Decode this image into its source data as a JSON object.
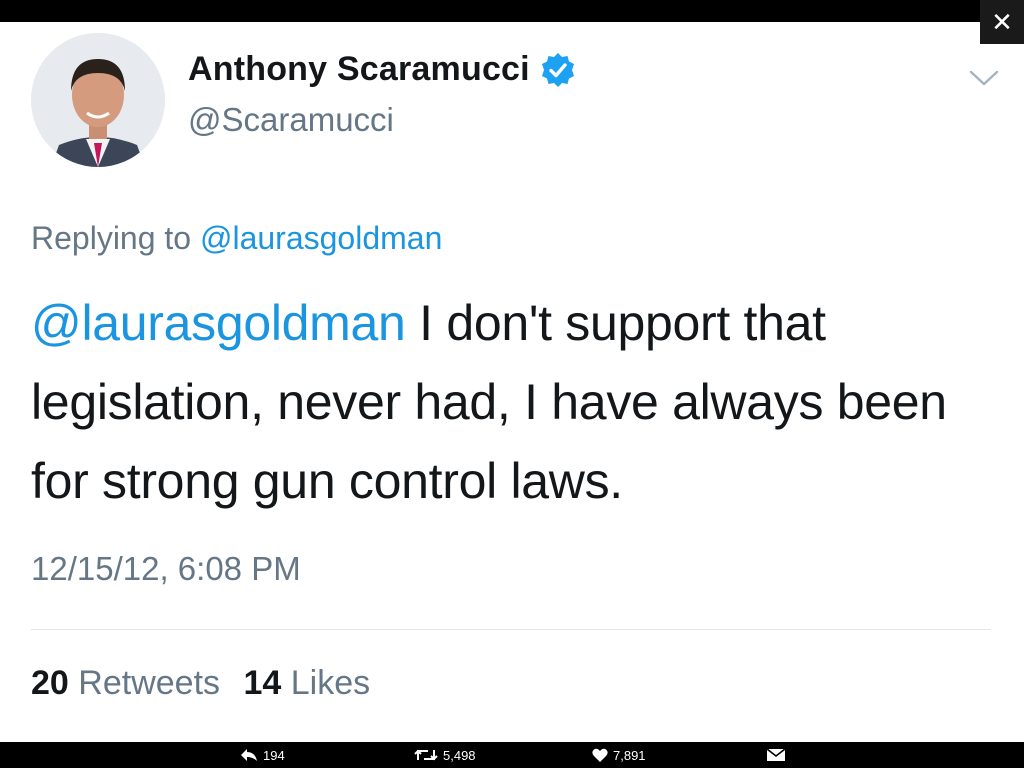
{
  "window": {
    "close_glyph": "✕",
    "close_icon": "close-icon"
  },
  "tweet": {
    "author_name": "Anthony Scaramucci",
    "verified": true,
    "handle": "@Scaramucci",
    "replying_prefix": "Replying to",
    "replying_to": "@laurasgoldman",
    "mention": "@laurasgoldman",
    "text": " I don't support that legislation, never had, I have always been for strong gun control laws.",
    "timestamp": "12/15/12, 6:08 PM",
    "retweets_count": "20",
    "retweets_label": "Retweets",
    "likes_count": "14",
    "likes_label": "Likes"
  },
  "action_bar": {
    "reply_count": "194",
    "retweet_count": "5,498",
    "like_count": "7,891",
    "reply_icon": "reply-icon",
    "retweet_icon": "retweet-icon",
    "like_icon": "heart-icon",
    "dm_icon": "envelope-icon"
  },
  "colors": {
    "link": "#1b95e0",
    "verified_badge": "#1da1f2",
    "text_primary": "#14171a",
    "text_secondary": "#657786"
  }
}
